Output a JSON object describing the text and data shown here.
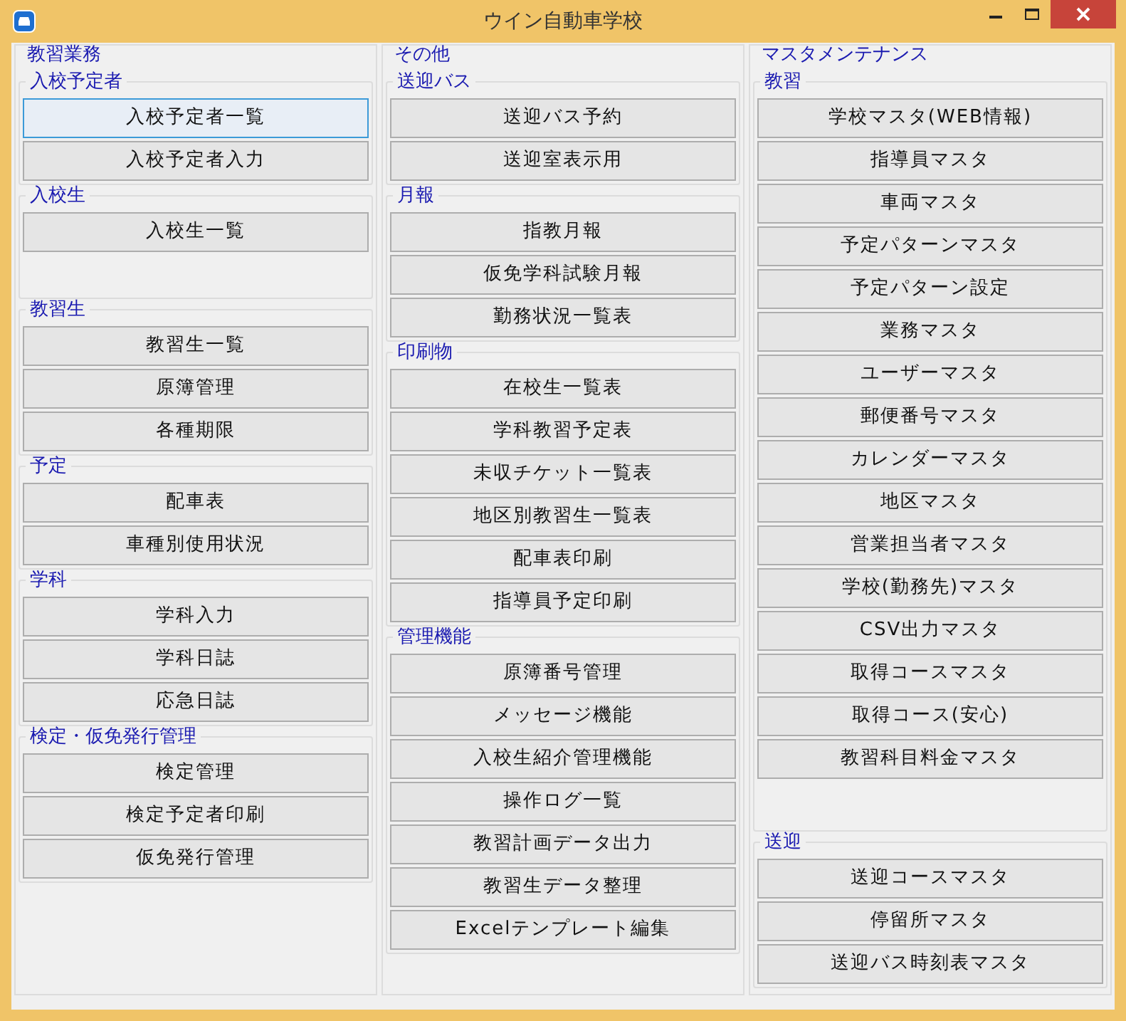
{
  "window": {
    "title": "ウイン自動車学校"
  },
  "columns": [
    {
      "title": "教習業務",
      "groups": [
        {
          "title": "入校予定者",
          "buttons": [
            {
              "label": "入校予定者一覧",
              "focused": true
            },
            {
              "label": "入校予定者入力",
              "focused": false
            }
          ]
        },
        {
          "title": "入校生",
          "buttons": [
            {
              "label": "入校生一覧",
              "focused": false
            }
          ]
        },
        {
          "title": "教習生",
          "buttons": [
            {
              "label": "教習生一覧",
              "focused": false
            },
            {
              "label": "原簿管理",
              "focused": false
            },
            {
              "label": "各種期限",
              "focused": false
            }
          ]
        },
        {
          "title": "予定",
          "buttons": [
            {
              "label": "配車表",
              "focused": false
            },
            {
              "label": "車種別使用状況",
              "focused": false
            }
          ]
        },
        {
          "title": "学科",
          "buttons": [
            {
              "label": "学科入力",
              "focused": false
            },
            {
              "label": "学科日誌",
              "focused": false
            },
            {
              "label": "応急日誌",
              "focused": false
            }
          ]
        },
        {
          "title": "検定・仮免発行管理",
          "buttons": [
            {
              "label": "検定管理",
              "focused": false
            },
            {
              "label": "検定予定者印刷",
              "focused": false
            },
            {
              "label": "仮免発行管理",
              "focused": false
            }
          ]
        }
      ]
    },
    {
      "title": "その他",
      "groups": [
        {
          "title": "送迎バス",
          "buttons": [
            {
              "label": "送迎バス予約",
              "focused": false
            },
            {
              "label": "送迎室表示用",
              "focused": false
            }
          ]
        },
        {
          "title": "月報",
          "buttons": [
            {
              "label": "指教月報",
              "focused": false
            },
            {
              "label": "仮免学科試験月報",
              "focused": false
            },
            {
              "label": "勤務状況一覧表",
              "focused": false
            }
          ]
        },
        {
          "title": "印刷物",
          "buttons": [
            {
              "label": "在校生一覧表",
              "focused": false
            },
            {
              "label": "学科教習予定表",
              "focused": false
            },
            {
              "label": "未収チケット一覧表",
              "focused": false
            },
            {
              "label": "地区別教習生一覧表",
              "focused": false
            },
            {
              "label": "配車表印刷",
              "focused": false
            },
            {
              "label": "指導員予定印刷",
              "focused": false
            }
          ]
        },
        {
          "title": "管理機能",
          "buttons": [
            {
              "label": "原簿番号管理",
              "focused": false
            },
            {
              "label": "メッセージ機能",
              "focused": false
            },
            {
              "label": "入校生紹介管理機能",
              "focused": false
            },
            {
              "label": "操作ログ一覧",
              "focused": false
            },
            {
              "label": "教習計画データ出力",
              "focused": false
            },
            {
              "label": "教習生データ整理",
              "focused": false
            },
            {
              "label": "Excelテンプレート編集",
              "focused": false
            }
          ]
        }
      ]
    },
    {
      "title": "マスタメンテナンス",
      "groups": [
        {
          "title": "教習",
          "buttons": [
            {
              "label": "学校マスタ(WEB情報)",
              "focused": false
            },
            {
              "label": "指導員マスタ",
              "focused": false
            },
            {
              "label": "車両マスタ",
              "focused": false
            },
            {
              "label": "予定パターンマスタ",
              "focused": false
            },
            {
              "label": "予定パターン設定",
              "focused": false
            },
            {
              "label": "業務マスタ",
              "focused": false
            },
            {
              "label": "ユーザーマスタ",
              "focused": false
            },
            {
              "label": "郵便番号マスタ",
              "focused": false
            },
            {
              "label": "カレンダーマスタ",
              "focused": false
            },
            {
              "label": "地区マスタ",
              "focused": false
            },
            {
              "label": "営業担当者マスタ",
              "focused": false
            },
            {
              "label": "学校(勤務先)マスタ",
              "focused": false
            },
            {
              "label": "CSV出力マスタ",
              "focused": false
            },
            {
              "label": "取得コースマスタ",
              "focused": false
            },
            {
              "label": "取得コース(安心)",
              "focused": false
            },
            {
              "label": "教習科目料金マスタ",
              "focused": false
            }
          ]
        },
        {
          "title": "送迎",
          "buttons": [
            {
              "label": "送迎コースマスタ",
              "focused": false
            },
            {
              "label": "停留所マスタ",
              "focused": false
            },
            {
              "label": "送迎バス時刻表マスタ",
              "focused": false
            }
          ]
        }
      ]
    }
  ]
}
